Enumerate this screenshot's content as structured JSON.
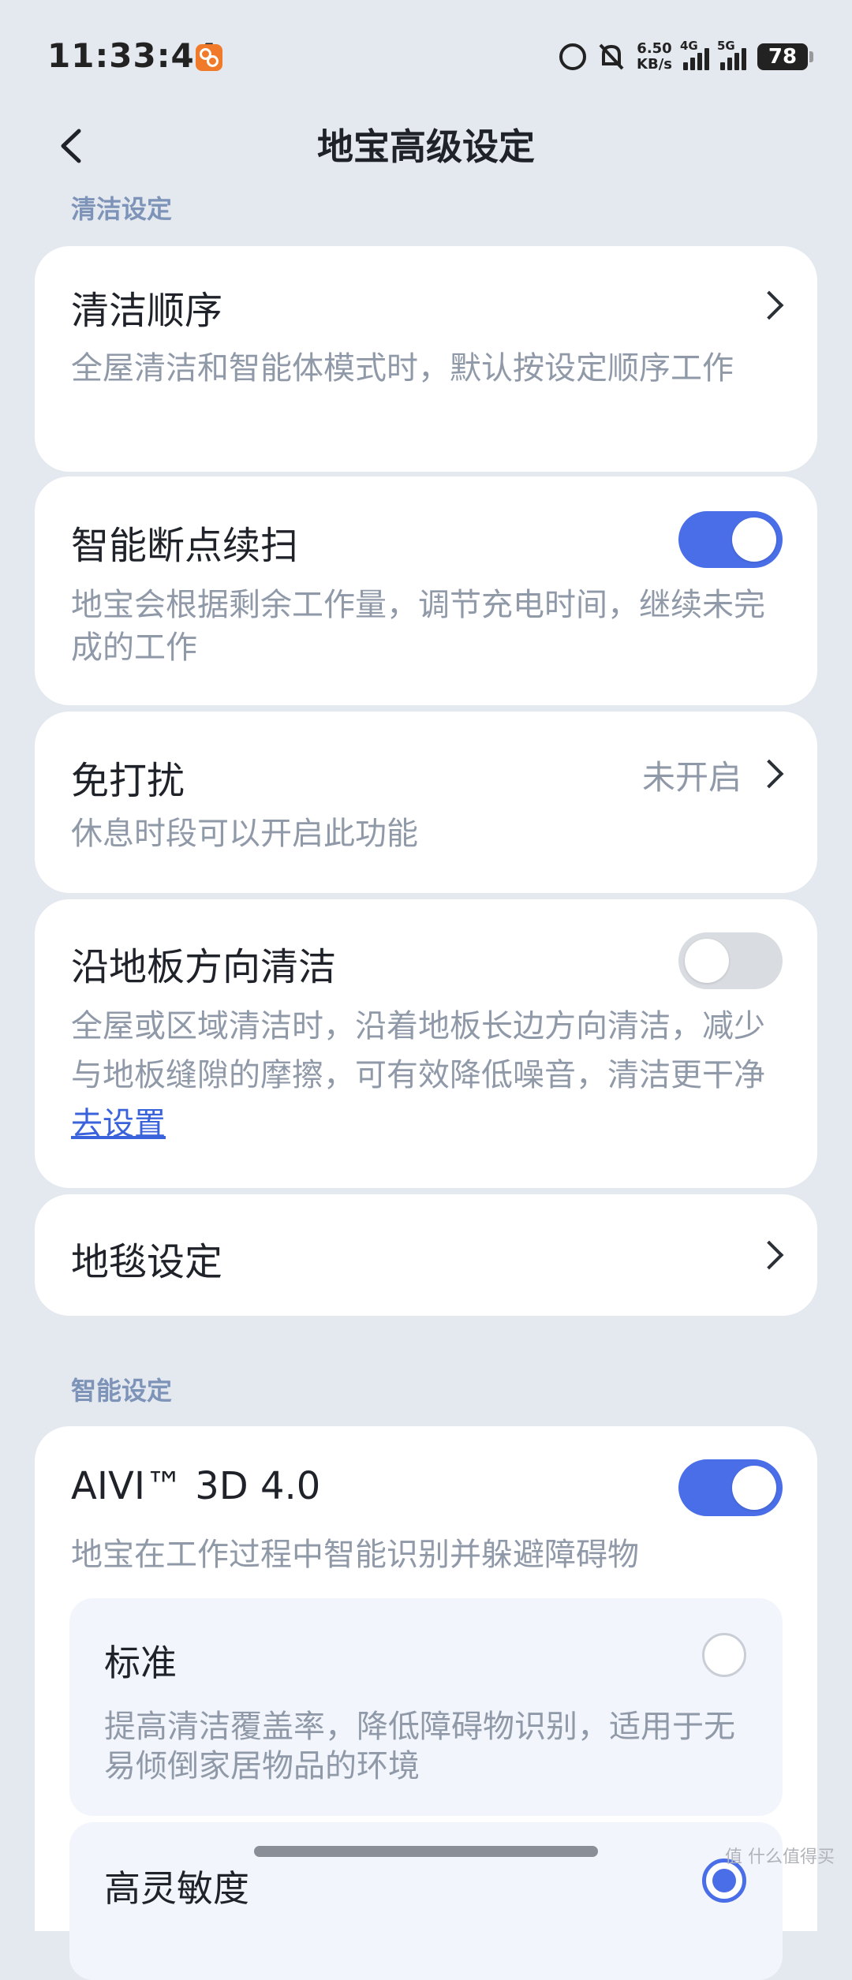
{
  "status_bar": {
    "time": "11:33:44",
    "net_speed_value": "6.50",
    "net_speed_unit": "KB/s",
    "signal1_label": "4G",
    "signal2_label": "5G",
    "battery": "78"
  },
  "header": {
    "title": "地宝高级设定"
  },
  "section_clean": {
    "label": "清洁设定"
  },
  "clean_order": {
    "title": "清洁顺序",
    "desc": "全屋清洁和智能体模式时，默认按设定顺序工作"
  },
  "resume": {
    "title": "智能断点续扫",
    "desc": "地宝会根据剩余工作量，调节充电时间，继续未完成的工作",
    "enabled": true
  },
  "dnd": {
    "title": "免打扰",
    "value": "未开启",
    "desc": "休息时段可以开启此功能"
  },
  "floor_direction": {
    "title": "沿地板方向清洁",
    "desc": "全屋或区域清洁时，沿着地板长边方向清洁，减少与地板缝隙的摩擦，可有效降低噪音，清洁更干净",
    "link": "去设置",
    "enabled": false
  },
  "carpet": {
    "title": "地毯设定"
  },
  "section_smart": {
    "label": "智能设定"
  },
  "aivi": {
    "title": "AIVI™ 3D 4.0",
    "desc": "地宝在工作过程中智能识别并躲避障碍物",
    "enabled": true,
    "options": [
      {
        "title": "标准",
        "desc": "提高清洁覆盖率，降低障碍物识别，适用于无易倾倒家居物品的环境",
        "selected": false
      },
      {
        "title": "高灵敏度",
        "selected": true
      }
    ]
  },
  "watermark": "值 什么值得买"
}
